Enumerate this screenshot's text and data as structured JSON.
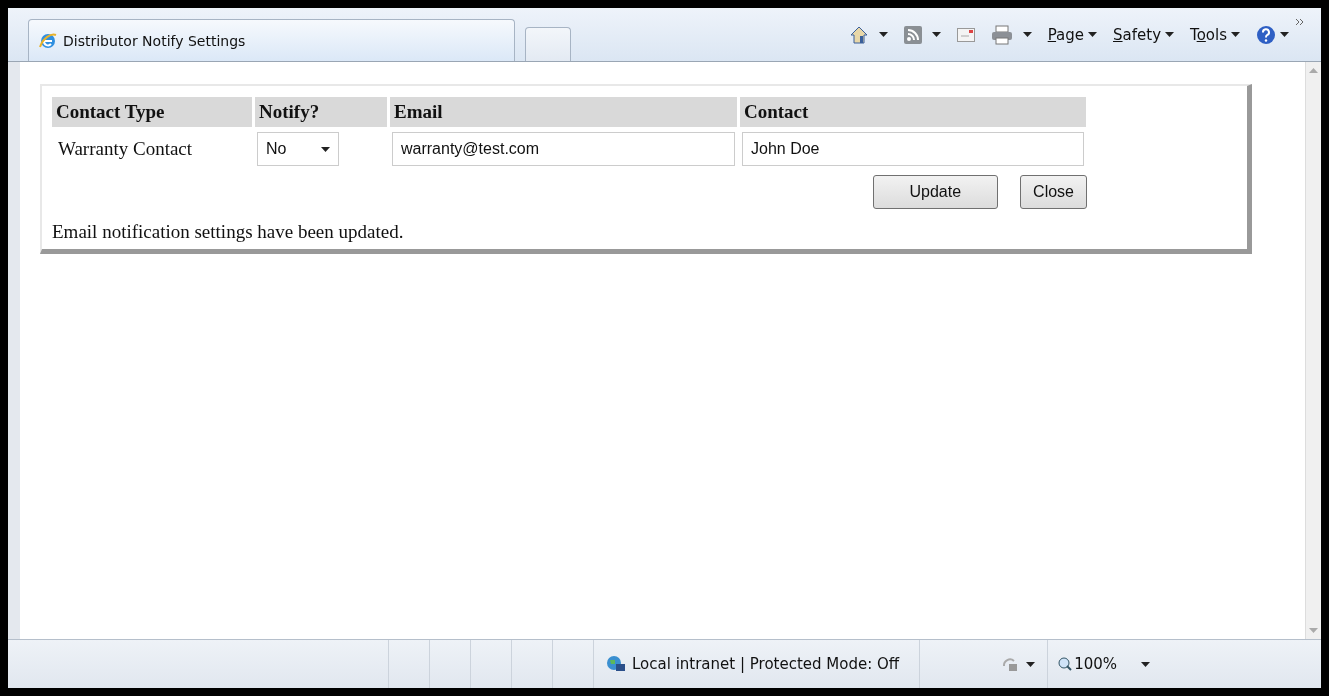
{
  "tab": {
    "title": "Distributor Notify Settings"
  },
  "toolbar": {
    "menus": [
      {
        "key": "P",
        "after": "age"
      },
      {
        "key": "S",
        "after": "afety"
      },
      {
        "before": "T",
        "key": "o",
        "after": "ols"
      }
    ]
  },
  "table": {
    "columns": [
      "Contact Type",
      "Notify?",
      "Email",
      "Contact"
    ],
    "rows": [
      {
        "contact_type": "Warranty Contact",
        "notify": "No",
        "email": "warranty@test.com",
        "contact": "John Doe"
      }
    ]
  },
  "buttons": [
    "Update",
    "Close"
  ],
  "message": "Email notification settings have been updated.",
  "status_bar": {
    "zone": "Local intranet | Protected Mode: Off",
    "zoom": "100%"
  }
}
